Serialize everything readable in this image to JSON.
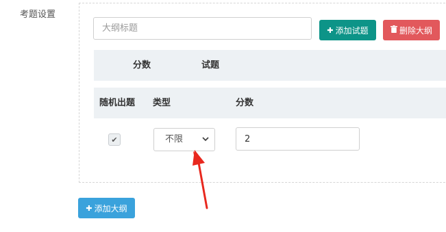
{
  "section": {
    "label": "考题设置"
  },
  "outline": {
    "title_placeholder": "大纲标题",
    "add_question_label": "添加试题",
    "delete_outline_label": "删除大纲"
  },
  "question_header": {
    "score": "分数",
    "question": "试题"
  },
  "random_header": {
    "random": "随机出题",
    "type": "类型",
    "score": "分数"
  },
  "random_row": {
    "checked": true,
    "type_value": "不限",
    "score_value": "2"
  },
  "add_outline_label": "添加大纲",
  "colors": {
    "add_question": "#0d9488",
    "delete": "#e2585c",
    "add_outline": "#3aa2dc",
    "annotation_arrow": "#e8281e"
  }
}
